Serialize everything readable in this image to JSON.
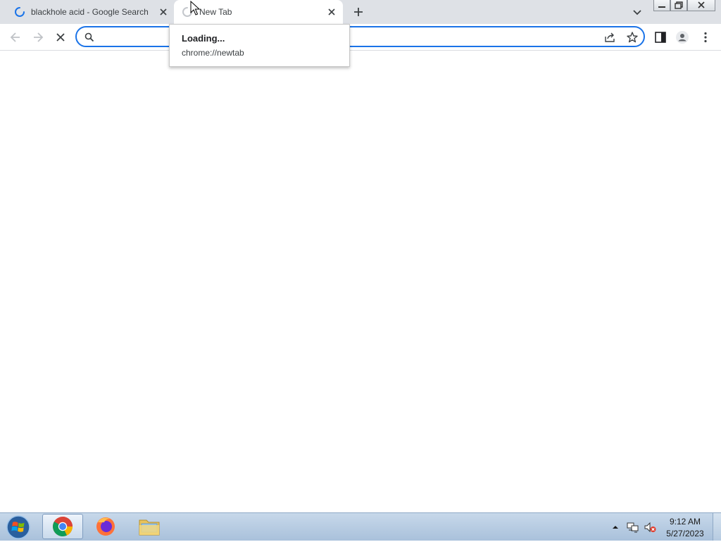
{
  "tabs": [
    {
      "title": "blackhole acid - Google Search",
      "loading": true,
      "active": false
    },
    {
      "title": "New Tab",
      "loading": true,
      "active": true
    }
  ],
  "icons": {
    "back": "back-arrow-icon",
    "forward": "forward-arrow-icon",
    "stop": "stop-icon",
    "search": "search-icon",
    "share": "share-icon",
    "bookmark": "star-icon",
    "side_panel": "side-panel-icon",
    "profile": "profile-icon",
    "menu": "kebab-menu-icon",
    "new_tab": "plus-icon",
    "tab_search": "chevron-down-icon"
  },
  "omnibox": {
    "value": "",
    "placeholder": ""
  },
  "hovercard": {
    "title": "Loading...",
    "url": "chrome://newtab"
  },
  "taskbar": {
    "apps": [
      "chrome",
      "firefox",
      "file-explorer"
    ],
    "time": "9:12 AM",
    "date": "5/27/2023"
  },
  "colors": {
    "accent": "#1a73e8",
    "tabstrip": "#dee1e6",
    "taskbar": "#b9cde3"
  }
}
